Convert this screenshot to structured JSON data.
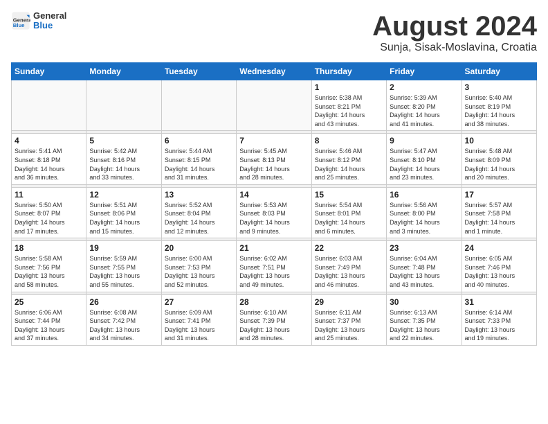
{
  "header": {
    "logo_general": "General",
    "logo_blue": "Blue",
    "month_title": "August 2024",
    "location": "Sunja, Sisak-Moslavina, Croatia"
  },
  "weekdays": [
    "Sunday",
    "Monday",
    "Tuesday",
    "Wednesday",
    "Thursday",
    "Friday",
    "Saturday"
  ],
  "weeks": [
    [
      {
        "day": "",
        "info": ""
      },
      {
        "day": "",
        "info": ""
      },
      {
        "day": "",
        "info": ""
      },
      {
        "day": "",
        "info": ""
      },
      {
        "day": "1",
        "info": "Sunrise: 5:38 AM\nSunset: 8:21 PM\nDaylight: 14 hours\nand 43 minutes."
      },
      {
        "day": "2",
        "info": "Sunrise: 5:39 AM\nSunset: 8:20 PM\nDaylight: 14 hours\nand 41 minutes."
      },
      {
        "day": "3",
        "info": "Sunrise: 5:40 AM\nSunset: 8:19 PM\nDaylight: 14 hours\nand 38 minutes."
      }
    ],
    [
      {
        "day": "4",
        "info": "Sunrise: 5:41 AM\nSunset: 8:18 PM\nDaylight: 14 hours\nand 36 minutes."
      },
      {
        "day": "5",
        "info": "Sunrise: 5:42 AM\nSunset: 8:16 PM\nDaylight: 14 hours\nand 33 minutes."
      },
      {
        "day": "6",
        "info": "Sunrise: 5:44 AM\nSunset: 8:15 PM\nDaylight: 14 hours\nand 31 minutes."
      },
      {
        "day": "7",
        "info": "Sunrise: 5:45 AM\nSunset: 8:13 PM\nDaylight: 14 hours\nand 28 minutes."
      },
      {
        "day": "8",
        "info": "Sunrise: 5:46 AM\nSunset: 8:12 PM\nDaylight: 14 hours\nand 25 minutes."
      },
      {
        "day": "9",
        "info": "Sunrise: 5:47 AM\nSunset: 8:10 PM\nDaylight: 14 hours\nand 23 minutes."
      },
      {
        "day": "10",
        "info": "Sunrise: 5:48 AM\nSunset: 8:09 PM\nDaylight: 14 hours\nand 20 minutes."
      }
    ],
    [
      {
        "day": "11",
        "info": "Sunrise: 5:50 AM\nSunset: 8:07 PM\nDaylight: 14 hours\nand 17 minutes."
      },
      {
        "day": "12",
        "info": "Sunrise: 5:51 AM\nSunset: 8:06 PM\nDaylight: 14 hours\nand 15 minutes."
      },
      {
        "day": "13",
        "info": "Sunrise: 5:52 AM\nSunset: 8:04 PM\nDaylight: 14 hours\nand 12 minutes."
      },
      {
        "day": "14",
        "info": "Sunrise: 5:53 AM\nSunset: 8:03 PM\nDaylight: 14 hours\nand 9 minutes."
      },
      {
        "day": "15",
        "info": "Sunrise: 5:54 AM\nSunset: 8:01 PM\nDaylight: 14 hours\nand 6 minutes."
      },
      {
        "day": "16",
        "info": "Sunrise: 5:56 AM\nSunset: 8:00 PM\nDaylight: 14 hours\nand 3 minutes."
      },
      {
        "day": "17",
        "info": "Sunrise: 5:57 AM\nSunset: 7:58 PM\nDaylight: 14 hours\nand 1 minute."
      }
    ],
    [
      {
        "day": "18",
        "info": "Sunrise: 5:58 AM\nSunset: 7:56 PM\nDaylight: 13 hours\nand 58 minutes."
      },
      {
        "day": "19",
        "info": "Sunrise: 5:59 AM\nSunset: 7:55 PM\nDaylight: 13 hours\nand 55 minutes."
      },
      {
        "day": "20",
        "info": "Sunrise: 6:00 AM\nSunset: 7:53 PM\nDaylight: 13 hours\nand 52 minutes."
      },
      {
        "day": "21",
        "info": "Sunrise: 6:02 AM\nSunset: 7:51 PM\nDaylight: 13 hours\nand 49 minutes."
      },
      {
        "day": "22",
        "info": "Sunrise: 6:03 AM\nSunset: 7:49 PM\nDaylight: 13 hours\nand 46 minutes."
      },
      {
        "day": "23",
        "info": "Sunrise: 6:04 AM\nSunset: 7:48 PM\nDaylight: 13 hours\nand 43 minutes."
      },
      {
        "day": "24",
        "info": "Sunrise: 6:05 AM\nSunset: 7:46 PM\nDaylight: 13 hours\nand 40 minutes."
      }
    ],
    [
      {
        "day": "25",
        "info": "Sunrise: 6:06 AM\nSunset: 7:44 PM\nDaylight: 13 hours\nand 37 minutes."
      },
      {
        "day": "26",
        "info": "Sunrise: 6:08 AM\nSunset: 7:42 PM\nDaylight: 13 hours\nand 34 minutes."
      },
      {
        "day": "27",
        "info": "Sunrise: 6:09 AM\nSunset: 7:41 PM\nDaylight: 13 hours\nand 31 minutes."
      },
      {
        "day": "28",
        "info": "Sunrise: 6:10 AM\nSunset: 7:39 PM\nDaylight: 13 hours\nand 28 minutes."
      },
      {
        "day": "29",
        "info": "Sunrise: 6:11 AM\nSunset: 7:37 PM\nDaylight: 13 hours\nand 25 minutes."
      },
      {
        "day": "30",
        "info": "Sunrise: 6:13 AM\nSunset: 7:35 PM\nDaylight: 13 hours\nand 22 minutes."
      },
      {
        "day": "31",
        "info": "Sunrise: 6:14 AM\nSunset: 7:33 PM\nDaylight: 13 hours\nand 19 minutes."
      }
    ]
  ]
}
